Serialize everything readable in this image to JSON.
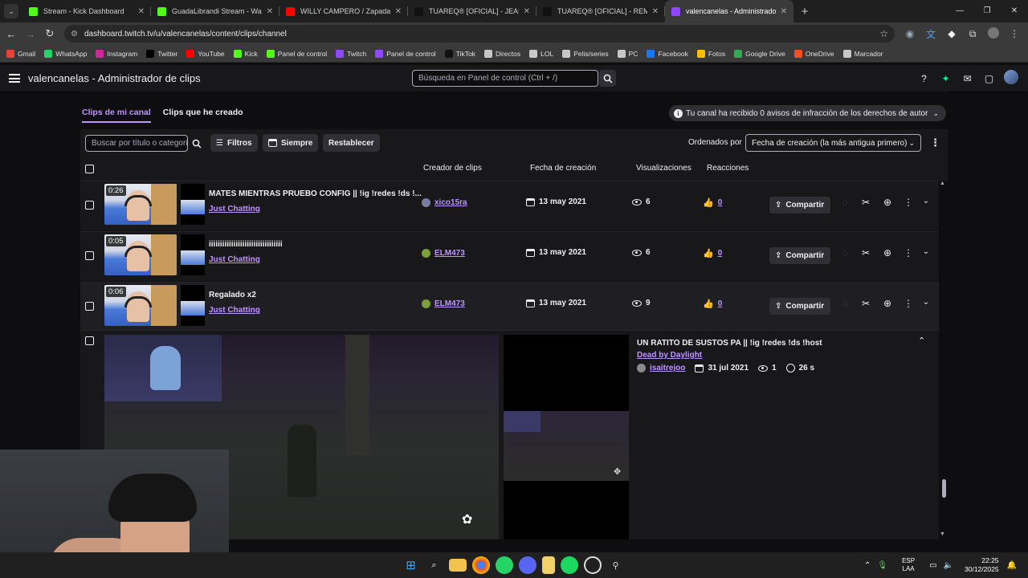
{
  "browser": {
    "tabs": [
      {
        "title": "Stream - Kick Dashboard",
        "icon": "kick-icon",
        "color": "#53fc18",
        "active": false
      },
      {
        "title": "GuadaLibrandi Stream - Watch",
        "icon": "kick-icon",
        "color": "#53fc18",
        "active": false
      },
      {
        "title": "WILLY CAMPERO / Zapada EN",
        "icon": "youtube-icon",
        "color": "#ff0000",
        "active": false
      },
      {
        "title": "TUAREQ® [OFICIAL] - JEAN M",
        "icon": "tuareq-icon",
        "color": "#111111",
        "active": false
      },
      {
        "title": "TUAREQ® [OFICIAL] - REMERA",
        "icon": "tuareq-icon",
        "color": "#111111",
        "active": false
      },
      {
        "title": "valencanelas - Administrador d",
        "icon": "twitch-icon",
        "color": "#9146ff",
        "active": true
      }
    ],
    "url": "dashboard.twitch.tv/u/valencanelas/content/clips/channel",
    "bookmarks": [
      {
        "label": "Gmail",
        "color": "#ea4335"
      },
      {
        "label": "WhatsApp",
        "color": "#25d366"
      },
      {
        "label": "Instagram",
        "color": "#d6249f"
      },
      {
        "label": "Twitter",
        "color": "#000000"
      },
      {
        "label": "YouTube",
        "color": "#ff0000"
      },
      {
        "label": "Kick",
        "color": "#53fc18"
      },
      {
        "label": "Panel de control",
        "color": "#53fc18"
      },
      {
        "label": "Twitch",
        "color": "#9146ff"
      },
      {
        "label": "Panel de control",
        "color": "#9146ff"
      },
      {
        "label": "TikTok",
        "color": "#111111"
      },
      {
        "label": "Directos",
        "color": "#c8c8c8"
      },
      {
        "label": "LOL",
        "color": "#c8c8c8"
      },
      {
        "label": "Pelis/series",
        "color": "#c8c8c8"
      },
      {
        "label": "PC",
        "color": "#c8c8c8"
      },
      {
        "label": "Facebook",
        "color": "#1877f2"
      },
      {
        "label": "Fotos",
        "color": "#fbbc04"
      },
      {
        "label": "Google Drive",
        "color": "#34a853"
      },
      {
        "label": "OneDrive",
        "color": "#f25022"
      },
      {
        "label": "Marcador",
        "color": "#c8c8c8"
      }
    ]
  },
  "header": {
    "title": "valencanelas - Administrador de clips",
    "search_placeholder": "Búsqueda en Panel de control (Ctrl + /)"
  },
  "subtabs": [
    {
      "label": "Clips de mi canal",
      "active": true
    },
    {
      "label": "Clips que he creado",
      "active": false
    }
  ],
  "copyright_notice": "Tu canal ha recibido 0 avisos de infracción de los derechos de autor",
  "toolbar": {
    "search_placeholder": "Buscar por título o categoría",
    "filters_label": "Filtros",
    "time_label": "Siempre",
    "reset_label": "Restablecer",
    "sort_label": "Ordenados por",
    "sort_value": "Fecha de creación (la más antigua primero)"
  },
  "columns": {
    "creator": "Creador de clips",
    "date": "Fecha de creación",
    "views": "Visualizaciones",
    "reactions": "Reacciones"
  },
  "share_label": "Compartir",
  "clips": [
    {
      "duration": "0:26",
      "title": "MATES MIENTRAS PRUEBO CONFIG || !ig !redes !ds !...",
      "category": "Just Chatting",
      "creator": "xico15ra",
      "date": "13 may 2021",
      "views": "6",
      "likes": "0",
      "highlight": false
    },
    {
      "duration": "0:05",
      "title": "iiiiiiiiiiiiiiiiiiiiiiiiiiiiiiiii",
      "category": "Just Chatting",
      "creator": "ELM473",
      "date": "13 may 2021",
      "views": "6",
      "likes": "0",
      "highlight": false
    },
    {
      "duration": "0:06",
      "title": "Regalado x2",
      "category": "Just Chatting",
      "creator": "ELM473",
      "date": "13 may 2021",
      "views": "9",
      "likes": "0",
      "highlight": true
    }
  ],
  "expanded_clip": {
    "title": "UN RATITO DE SUSTOS PA || !ig !redes !ds !host",
    "category": "Dead by Daylight",
    "creator": "isaitrejoo",
    "date": "31 jul 2021",
    "views": "1",
    "duration": "26 s"
  },
  "taskbar": {
    "lang_top": "ESP",
    "lang_bottom": "LAA",
    "time": "22:25",
    "date": "30/12/2025"
  },
  "colors": {
    "accent": "#bf94ff",
    "twitch": "#9146ff"
  }
}
